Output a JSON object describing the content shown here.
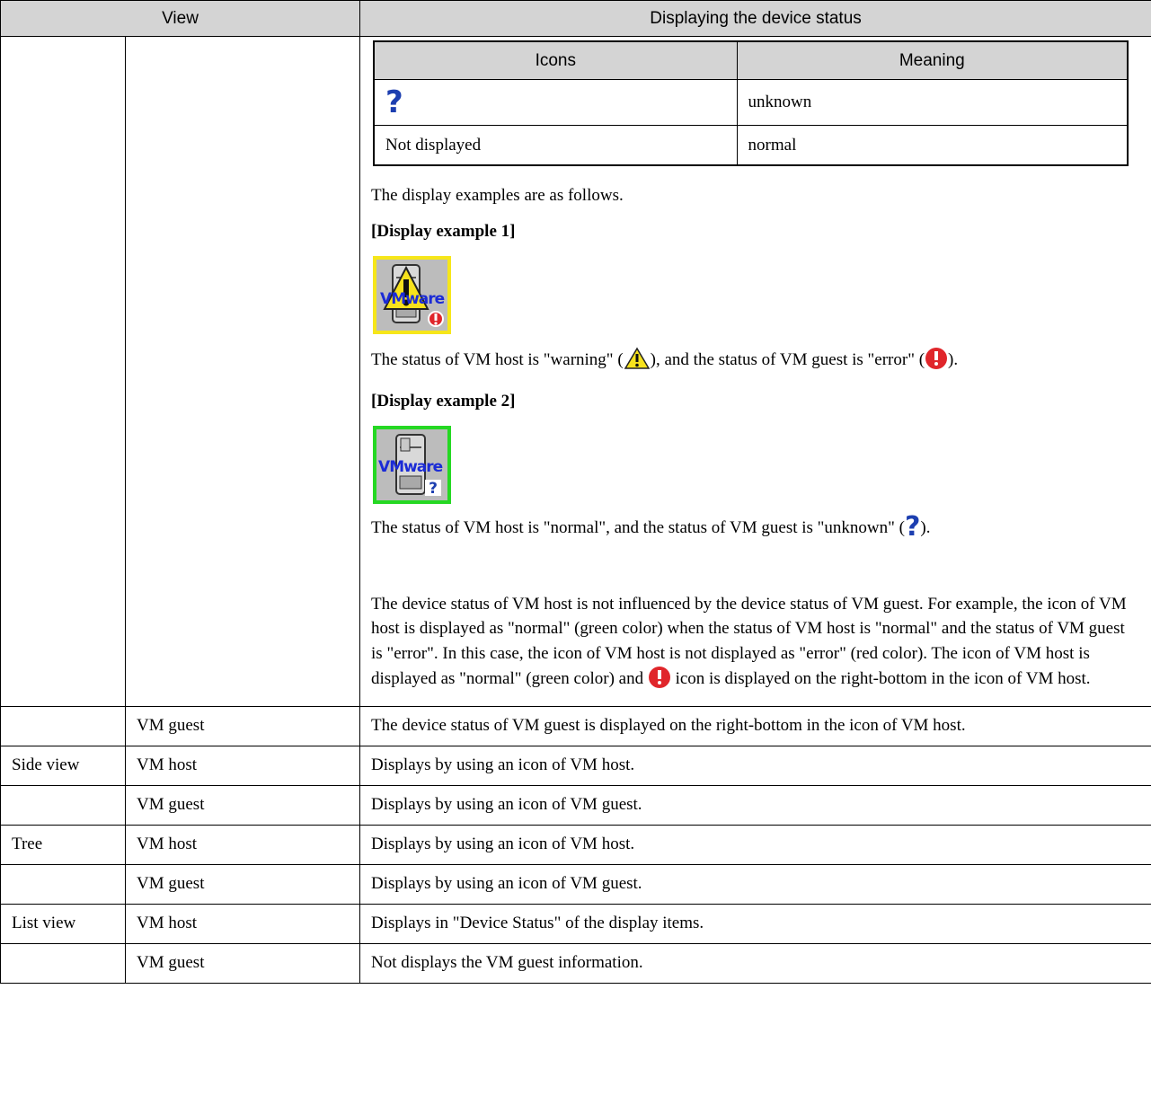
{
  "header": {
    "view": "View",
    "display": "Displaying the device status"
  },
  "icons_table": {
    "col_icons": "Icons",
    "col_meaning": "Meaning",
    "rows": [
      {
        "icon": "question-icon",
        "icon_text": "",
        "meaning": "unknown"
      },
      {
        "icon": "",
        "icon_text": "Not displayed",
        "meaning": "normal"
      }
    ]
  },
  "content": {
    "intro": "The display examples are as follows.",
    "example1_heading": "[Display example 1]",
    "example1_icon_label": "VMware",
    "example1_text_a": "The status of VM host is \"warning\" (",
    "example1_text_b": "), and the status of VM guest is \"error\" (",
    "example1_text_c": ").",
    "example2_heading": "[Display example 2]",
    "example2_icon_label": "VMware",
    "example2_text_a": "The status of VM host is \"normal\", and the status of VM guest is \"unknown\" (",
    "example2_text_b": ").",
    "note_a": "The device status of VM host is not influenced by the device status of VM guest. For example, the icon of VM host is displayed as \"normal\" (green color) when the status of VM host is \"normal\" and the status of VM guest is \"error\". In this case, the icon of VM host is not displayed as \"error\" (red color). The icon of VM host is displayed as \"normal\" (green color) and",
    "note_b": "icon is displayed on the right-bottom in the icon of VM host.",
    "colors": {
      "warning": "#f6e61a",
      "normal": "#25d823",
      "error": "#e0262b",
      "unknown": "#1d3fb0"
    }
  },
  "rows": [
    {
      "view": "",
      "type": "VM guest",
      "desc": "The device status of VM guest is displayed on the right-bottom in the icon of VM host."
    },
    {
      "view": "Side view",
      "type": "VM host",
      "desc": "Displays by using an icon of VM host."
    },
    {
      "view": "",
      "type": "VM guest",
      "desc": "Displays by using an icon of VM guest."
    },
    {
      "view": "Tree",
      "type": "VM host",
      "desc": "Displays by using an icon of VM host."
    },
    {
      "view": "",
      "type": "VM guest",
      "desc": "Displays by using an icon of VM guest."
    },
    {
      "view": "List view",
      "type": "VM host",
      "desc": "Displays in \"Device Status\" of the display items."
    },
    {
      "view": "",
      "type": "VM guest",
      "desc": "Not displays the VM guest information."
    }
  ]
}
